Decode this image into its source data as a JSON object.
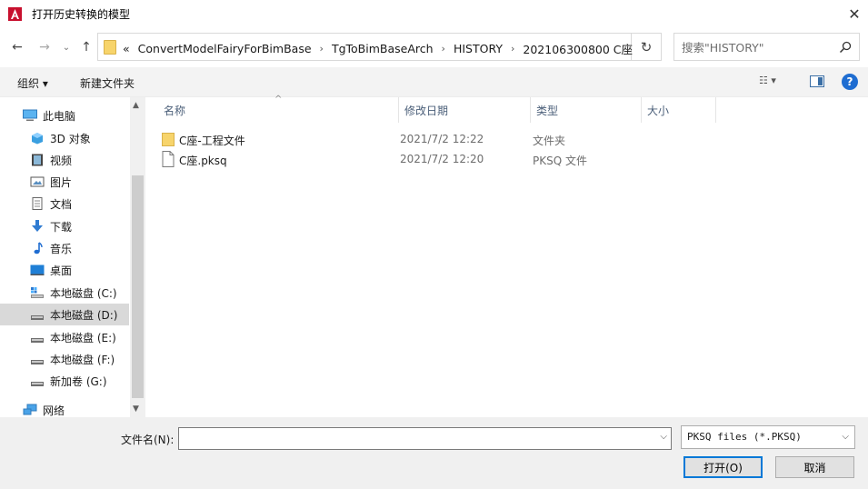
{
  "window": {
    "title": "打开历史转换的模型",
    "close_glyph": "✕"
  },
  "nav_buttons": {
    "back": "←",
    "forward": "→",
    "recent": "⌄",
    "up": "↑"
  },
  "address": {
    "overflow": "«",
    "crumbs": [
      "ConvertModelFairyForBimBase",
      "TgToBimBaseArch",
      "HISTORY",
      "202106300800 C座"
    ],
    "separator": "›",
    "refresh_glyph": "↻"
  },
  "search": {
    "placeholder": "搜索\"HISTORY\""
  },
  "toolbar": {
    "organize_label": "组织 ▾",
    "new_folder_label": "新建文件夹",
    "view_glyph": "☷ ▾",
    "help_glyph": "?"
  },
  "sidebar": {
    "items": [
      {
        "label": "此电脑",
        "icon": "pc-icon"
      },
      {
        "label": "3D 对象",
        "icon": "3d-objects-icon"
      },
      {
        "label": "视频",
        "icon": "video-icon"
      },
      {
        "label": "图片",
        "icon": "pictures-icon"
      },
      {
        "label": "文档",
        "icon": "documents-icon"
      },
      {
        "label": "下载",
        "icon": "download-icon"
      },
      {
        "label": "音乐",
        "icon": "music-icon"
      },
      {
        "label": "桌面",
        "icon": "desktop-icon"
      },
      {
        "label": "本地磁盘 (C:)",
        "icon": "system-drive-icon"
      },
      {
        "label": "本地磁盘 (D:)",
        "icon": "drive-icon"
      },
      {
        "label": "本地磁盘 (E:)",
        "icon": "drive-icon"
      },
      {
        "label": "本地磁盘 (F:)",
        "icon": "drive-icon"
      },
      {
        "label": "新加卷 (G:)",
        "icon": "drive-icon"
      },
      {
        "label": "网络",
        "icon": "network-icon"
      }
    ],
    "selected": "本地磁盘 (D:)",
    "scroll_up": "▲",
    "scroll_down": "▼"
  },
  "file_list": {
    "columns": [
      "名称",
      "修改日期",
      "类型",
      "大小"
    ],
    "sort_indicator": "^",
    "rows": [
      {
        "name": "C座-工程文件",
        "date": "2021/7/2 12:22",
        "type": "文件夹",
        "size": "",
        "icon": "folder-icon"
      },
      {
        "name": "C座.pksq",
        "date": "2021/7/2 12:20",
        "type": "PKSQ 文件",
        "size": "",
        "icon": "file-icon"
      }
    ]
  },
  "bottom": {
    "filename_label": "文件名(N):",
    "filename_value": "",
    "filetype_value": "PKSQ files (*.PKSQ)",
    "open_label": "打开(O)",
    "cancel_label": "取消",
    "dropdown_glyph": "⌵"
  },
  "colors": {
    "accent": "#0078d7",
    "app_red": "#c8102e",
    "folder": "#f7d46b"
  }
}
